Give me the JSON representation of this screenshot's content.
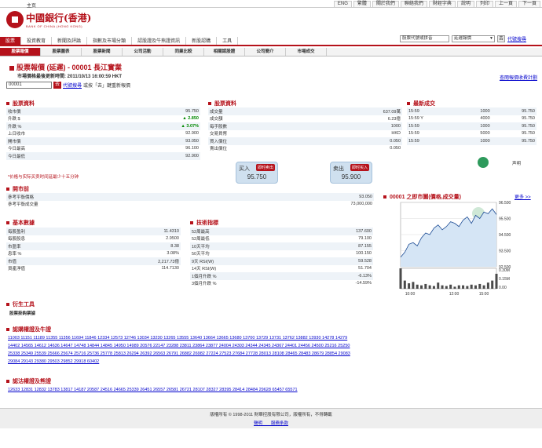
{
  "topbar": {
    "home": "主页",
    "links": [
      "ENG",
      "繁體",
      "關於我們",
      "聯絡我們",
      "財經字典",
      "說明",
      "列印",
      "上一頁",
      "下一頁"
    ]
  },
  "logo": {
    "name": "中國銀行(香港)",
    "sub": "BANK OF CHINA (HONG KONG)"
  },
  "nav1": [
    "股票",
    "投資教育",
    "新聞及評論",
    "指數及市場分類",
    "認股證及牛熊證資訊",
    "新股認購",
    "工具"
  ],
  "symbol": {
    "placeholder": "股票代號或拼音",
    "select": "延遲報價",
    "go": "去",
    "link": "代號搜尋"
  },
  "nav2": [
    "股票報價",
    "股票圖表",
    "股票新聞",
    "公司活動",
    "同業比較",
    "相關認股證",
    "公司簡介",
    "市場成交"
  ],
  "title": "股票報價 (延遲) - 00001 長江實業",
  "updated": "市場價格最後更新時間: 2011/10/13 16:00:59 HKT",
  "stock_link": "查閱報價收費計劃",
  "code": {
    "value": "00001",
    "go": "去",
    "link": "代號搜尋",
    "hint": "或按「去」鍵重新報價"
  },
  "quote": {
    "header": "股票資料",
    "rows": [
      [
        "收市價",
        "95.750"
      ],
      [
        "升跌 $",
        "▲ 2.850"
      ],
      [
        "升跌 %",
        "▲ 3.07%"
      ],
      [
        "上日收市",
        "92.900"
      ],
      [
        "開市價",
        "93.050"
      ],
      [
        "今日最高",
        "96.100"
      ],
      [
        "今日最低",
        "92.900"
      ]
    ]
  },
  "quote2": {
    "header": "股票資料",
    "rows": [
      [
        "成交量",
        "637.09萬"
      ],
      [
        "成交額",
        "6.23億"
      ],
      [
        "每手股數",
        "1000"
      ],
      [
        "交易貨幣",
        "HKD"
      ],
      [
        "買入價位",
        "0.050"
      ],
      [
        "賣出價位",
        "0.050"
      ]
    ]
  },
  "trades": {
    "header": "最新成交",
    "rows": [
      [
        "15:59",
        "1000",
        "95.750"
      ],
      [
        "15:59 Y",
        "4000",
        "95.750"
      ],
      [
        "15:59",
        "1000",
        "95.750"
      ],
      [
        "15:59",
        "5000",
        "95.750"
      ],
      [
        "15:59",
        "1000",
        "95.750"
      ]
    ]
  },
  "note": "*价格与实际买卖时间延最少十五分钟",
  "buy": {
    "label": "买入",
    "tag": "即时卖出",
    "price": "95.750"
  },
  "sell": {
    "label": "卖出",
    "tag": "即时买入",
    "price": "95.900"
  },
  "trade_logo": {
    "a": "",
    "b": "声明"
  },
  "open": {
    "header": "開市前",
    "rows": [
      [
        "參考平衡價格",
        "93.050"
      ],
      [
        "參考平衡成交量",
        "73,000,000"
      ]
    ]
  },
  "chart": {
    "header": "00001 之即市圖(價格,成交量)",
    "more": "更多 >>",
    "price_ticks": [
      "96.500",
      "95.500",
      "94.500",
      "93.500",
      "92.500"
    ],
    "vol_ticks": [
      "0.30M",
      "0.15M",
      "0.00"
    ],
    "x_ticks": [
      "10:00",
      "12:00",
      "15:00"
    ]
  },
  "fund": {
    "header": "基本數據",
    "rows": [
      [
        "每股盈利",
        "11.4310"
      ],
      [
        "每股股息",
        "2.9500"
      ],
      [
        "市盈率",
        "8.38"
      ],
      [
        "息率 %",
        "3.08%"
      ],
      [
        "市值",
        "2,217.73億"
      ],
      [
        "資產淨值",
        "114.7130"
      ]
    ]
  },
  "tech": {
    "header": "技術指標",
    "rows": [
      [
        "52周最高",
        "137.600"
      ],
      [
        "52周最低",
        "79.100"
      ],
      [
        "10天平均",
        "87.155"
      ],
      [
        "50天平均",
        "100.150"
      ],
      [
        "9天 RSI(W)",
        "59.528"
      ],
      [
        "14天 RSI(W)",
        "51.704"
      ],
      [
        "1個月升跌 %",
        "-6.13%"
      ],
      [
        "3個月升跌 %",
        "-14.59%"
      ]
    ]
  },
  "deriv": {
    "header": "衍生工具",
    "sub": "股票掛鈎票據"
  },
  "warrants": {
    "header": "認購權證及牛證",
    "lines": [
      "11003 11151 11189 11355 11356 11694 11846 12334 12573 12746 13034 13230 13265 13555 13640 13664 13665 13680 13700 13729 13731 13762 13882 13930 14278 14279",
      "14402 14565 14612 14636 14647 14748 14844 14845 14950 14989 20576 22147 23288 23811 23864 23877 24004 24303 24344 24345 24367 24401 24456 24500 25216 25250",
      "25338 25349 25539 25666 25674 25716 25736 25778 25813 26294 26392 26563 26791 26882 26982 27224 27523 27684 27728 28013 28108 28465 28483 28679 28854 29083",
      "29084 29143 29380 29503 29852 29918 60402"
    ]
  },
  "puts": {
    "header": "認沽權證及熊證",
    "lines": [
      "12633 12831 12832 13783 13817 14187 20587 24516 24665 25339 26451 26557 26581 26721 28107 28327 28395 28414 28484 29628 65457 65571"
    ]
  },
  "footer": {
    "copy": "版權所有 © 1998-2011 財華控股有限公司，版權所有，不得轉載",
    "links": "聲明　　服務条款"
  },
  "chart_data": {
    "type": "line",
    "x_ticks": [
      "10:00",
      "12:00",
      "15:00"
    ],
    "price_range": [
      92.5,
      96.5
    ],
    "price": [
      93.1,
      93.4,
      93.9,
      94.0,
      93.8,
      94.3,
      94.6,
      94.5,
      94.9,
      95.1,
      94.8,
      95.0,
      95.3,
      95.2,
      95.0,
      95.4,
      95.6,
      95.2,
      95.7,
      95.5,
      95.9,
      95.8,
      96.1,
      95.75
    ],
    "volume": [
      0.3,
      0.12,
      0.08,
      0.1,
      0.06,
      0.05,
      0.07,
      0.05,
      0.04,
      0.09,
      0.05,
      0.04,
      0.06,
      0.03,
      0.05,
      0.05,
      0.04,
      0.06,
      0.05,
      0.07,
      0.05,
      0.09,
      0.12,
      0.22
    ]
  }
}
